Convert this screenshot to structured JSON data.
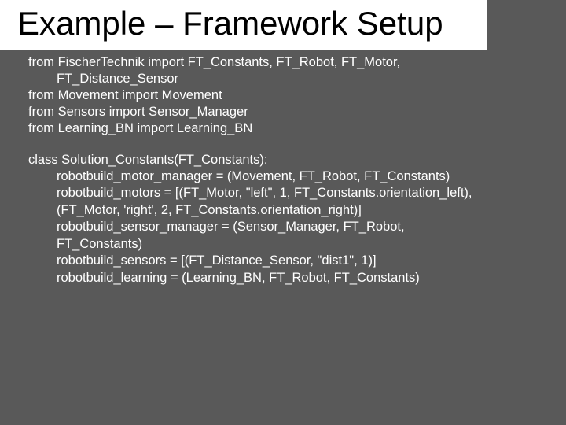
{
  "title": "Example – Framework Setup",
  "imports": {
    "l1a": "from FischerTechnik import FT_Constants, FT_Robot, FT_Motor,",
    "l1b": "FT_Distance_Sensor",
    "l2": "from Movement import Movement",
    "l3": "from Sensors import Sensor_Manager",
    "l4": "from Learning_BN import Learning_BN"
  },
  "cls": {
    "def": "class Solution_Constants(FT_Constants):",
    "b1": "robotbuild_motor_manager = (Movement, FT_Robot, FT_Constants)",
    "b2": "robotbuild_motors = [(FT_Motor, \"left\", 1, FT_Constants.orientation_left),",
    "b3": "(FT_Motor, 'right', 2, FT_Constants.orientation_right)]",
    "b4": "robotbuild_sensor_manager = (Sensor_Manager, FT_Robot,",
    "b5": "FT_Constants)",
    "b6": "robotbuild_sensors = [(FT_Distance_Sensor, \"dist1\", 1)]",
    "b7": "robotbuild_learning = (Learning_BN, FT_Robot, FT_Constants)"
  }
}
